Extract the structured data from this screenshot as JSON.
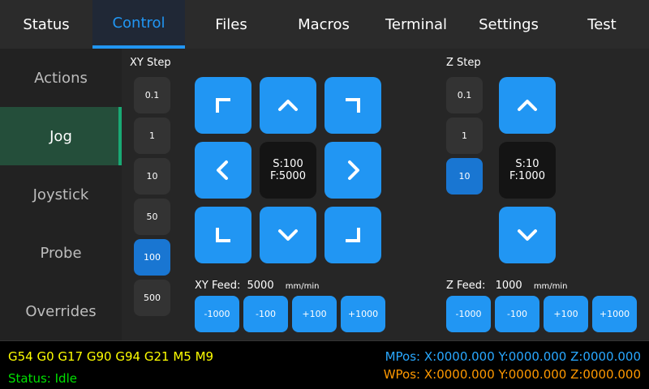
{
  "nav": {
    "tabs": [
      "Status",
      "Control",
      "Files",
      "Macros",
      "Terminal",
      "Settings",
      "Test"
    ],
    "active": "Control"
  },
  "sidebar": {
    "items": [
      "Actions",
      "Jog",
      "Joystick",
      "Probe",
      "Overrides"
    ],
    "active": "Jog"
  },
  "xy": {
    "step_label": "XY Step",
    "steps": [
      "0.1",
      "1",
      "10",
      "50",
      "100",
      "500"
    ],
    "selected_step": "100",
    "speed": "S:100",
    "feed": "F:5000",
    "feed_label": "XY Feed:",
    "feed_value": "5000",
    "feed_unit": "mm/min",
    "feed_buttons": [
      "-1000",
      "-100",
      "+100",
      "+1000"
    ],
    "jog_icons": [
      "arrow-up-left-icon",
      "arrow-up-icon",
      "arrow-up-right-icon",
      "arrow-left-icon",
      "arrow-right-icon",
      "arrow-down-left-icon",
      "arrow-down-icon",
      "arrow-down-right-icon"
    ]
  },
  "z": {
    "step_label": "Z Step",
    "steps": [
      "0.1",
      "1",
      "10"
    ],
    "selected_step": "10",
    "speed": "S:10",
    "feed": "F:1000",
    "feed_label": "Z Feed:",
    "feed_value": "1000",
    "feed_unit": "mm/min",
    "feed_buttons": [
      "-1000",
      "-100",
      "+100",
      "+1000"
    ],
    "jog_icons": [
      "arrow-up-icon",
      "arrow-down-icon"
    ]
  },
  "status": {
    "gcode": "G54 G0 G17 G90 G94 G21 M5 M9",
    "state": "Status: Idle",
    "mpos": "MPos: X:0000.000 Y:0000.000 Z:0000.000",
    "wpos": "WPos: X:0000.000 Y:0000.000 Z:0000.000"
  },
  "colors": {
    "accent": "#2196f3",
    "selected_step": "#1976d2",
    "sidebar_active": "#244e3a",
    "sidebar_indicator": "#19a974",
    "gcode": "#ffff00",
    "state": "#00e000",
    "mpos": "#29a8ff",
    "wpos": "#ff9800"
  }
}
